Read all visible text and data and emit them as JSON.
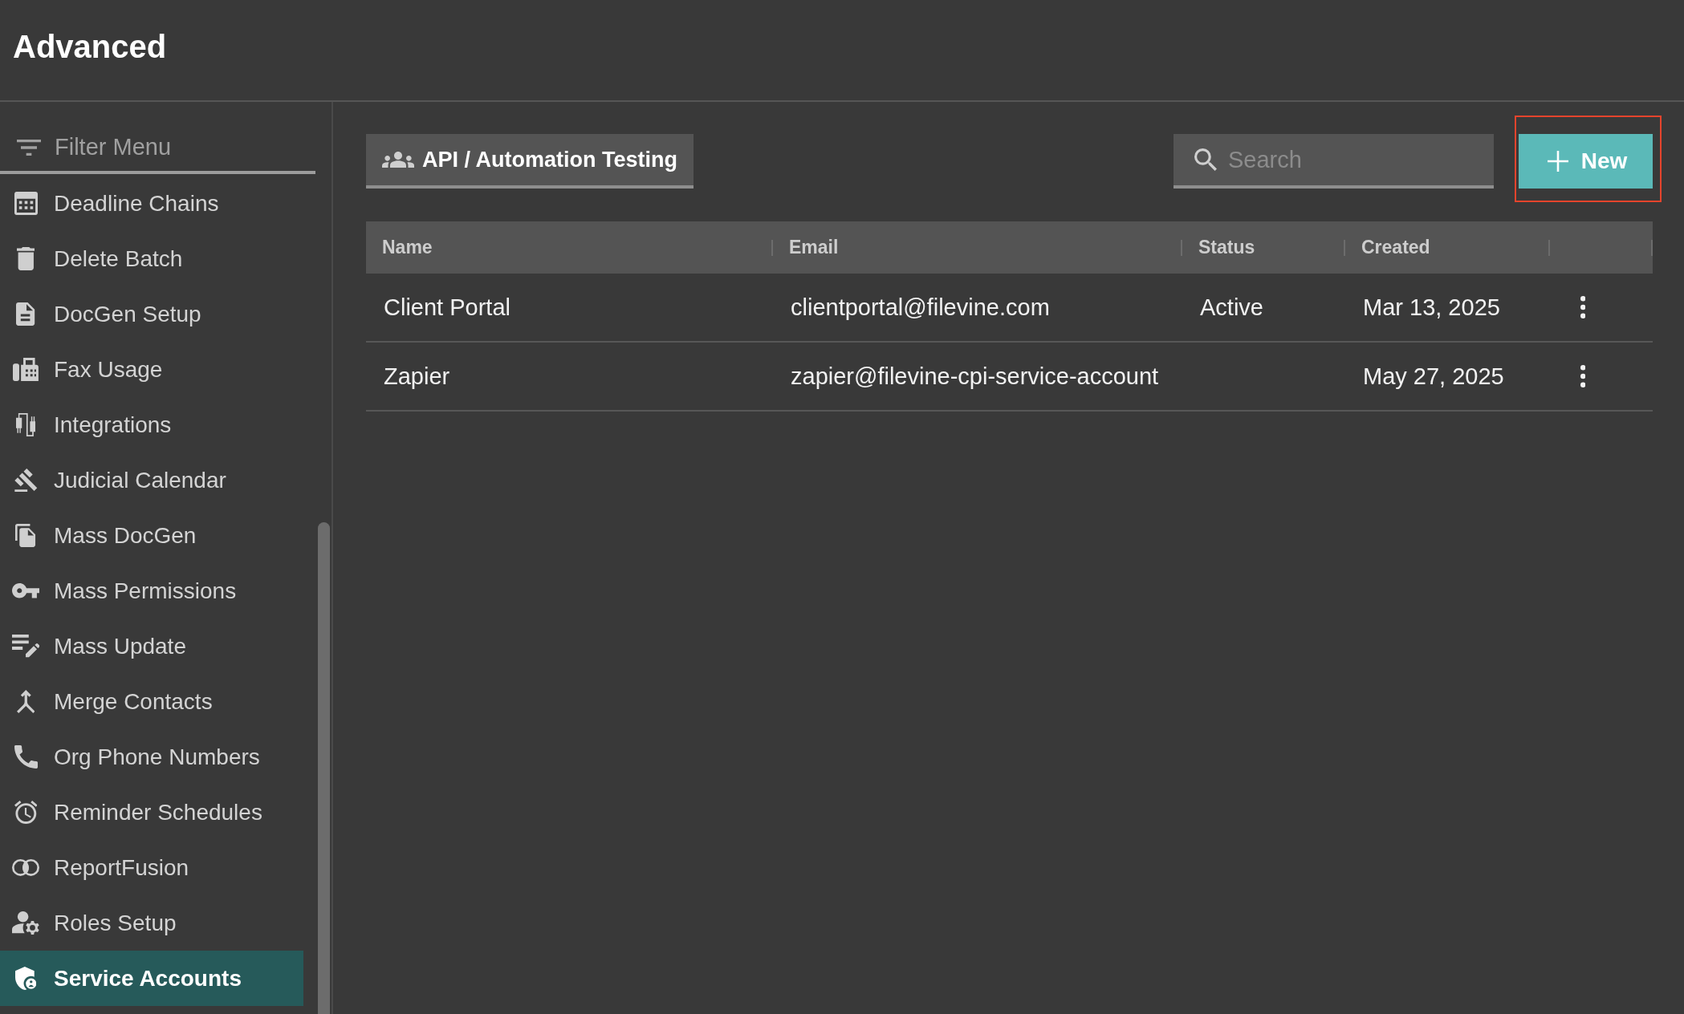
{
  "header": {
    "title": "Advanced"
  },
  "sidebar": {
    "filter": {
      "placeholder": "Filter Menu"
    },
    "items": [
      {
        "label": "Deadline Chains",
        "selected": false
      },
      {
        "label": "Delete Batch",
        "selected": false
      },
      {
        "label": "DocGen Setup",
        "selected": false
      },
      {
        "label": "Fax Usage",
        "selected": false
      },
      {
        "label": "Integrations",
        "selected": false
      },
      {
        "label": "Judicial Calendar",
        "selected": false
      },
      {
        "label": "Mass DocGen",
        "selected": false
      },
      {
        "label": "Mass Permissions",
        "selected": false
      },
      {
        "label": "Mass Update",
        "selected": false
      },
      {
        "label": "Merge Contacts",
        "selected": false
      },
      {
        "label": "Org Phone Numbers",
        "selected": false
      },
      {
        "label": "Reminder Schedules",
        "selected": false
      },
      {
        "label": "ReportFusion",
        "selected": false
      },
      {
        "label": "Roles Setup",
        "selected": false
      },
      {
        "label": "Service Accounts",
        "selected": true
      }
    ]
  },
  "content": {
    "group_button": {
      "label": "API / Automation Testing"
    },
    "search": {
      "placeholder": "Search"
    },
    "new_button": {
      "label": "New",
      "highlighted": true
    },
    "table": {
      "columns": [
        "Name",
        "Email",
        "Status",
        "Created"
      ],
      "rows": [
        {
          "name": "Client Portal",
          "email": "clientportal@filevine.com",
          "status": "Active",
          "created": "Mar 13, 2025"
        },
        {
          "name": "Zapier",
          "email": "zapier@filevine-cpi-service-account",
          "created": "May 27, 2025"
        }
      ]
    }
  }
}
